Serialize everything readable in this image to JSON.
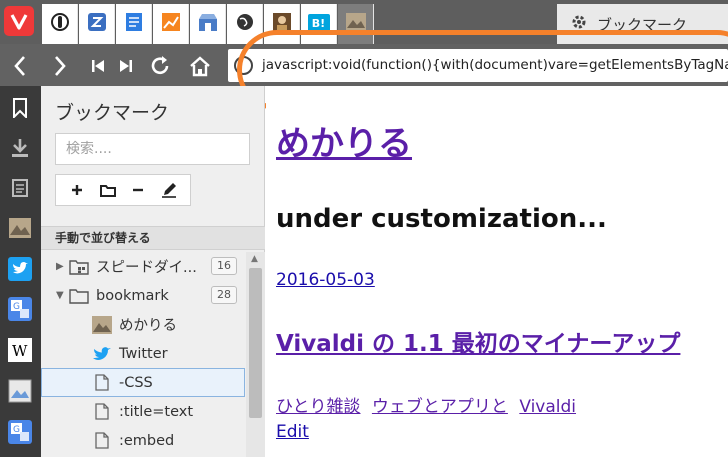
{
  "browser": {
    "logo_icon": "vivaldi-logo",
    "pinned_tabs": [
      {
        "icon": "opera-speed-icon"
      },
      {
        "icon": "z-app-icon"
      },
      {
        "icon": "document-app-icon"
      },
      {
        "icon": "chart-app-icon"
      },
      {
        "icon": "store-app-icon"
      },
      {
        "icon": "globe-icon"
      },
      {
        "icon": "avatar-icon"
      },
      {
        "icon": "hatena-bookmark-icon",
        "text": "B!"
      },
      {
        "icon": "image-thumbnail-icon"
      }
    ],
    "active_tab": {
      "icon": "gear-icon",
      "title": "ブックマーク"
    }
  },
  "addressbar": {
    "url": "javascript:void(function(){with(document)vare=getElementsByTagName",
    "highlight_color": "#f5812b"
  },
  "panel": {
    "title": "ブックマーク",
    "search_placeholder": "検索....",
    "sort_label": "手動で並び替える",
    "tree": [
      {
        "label": "スピードダイ...",
        "count": "16",
        "icon": "speed-dial-folder-icon",
        "arrow": "▶"
      },
      {
        "label": "bookmark",
        "count": "28",
        "icon": "folder-icon",
        "arrow": "▼"
      },
      {
        "label": "めかりる",
        "icon": "site-favicon-icon"
      },
      {
        "label": "Twitter",
        "icon": "twitter-bird-icon"
      },
      {
        "label": "-CSS",
        "icon": "page-icon",
        "selected": true
      },
      {
        "label": ":title=text",
        "icon": "page-icon"
      },
      {
        "label": ":embed",
        "icon": "page-icon"
      }
    ]
  },
  "content": {
    "site_title": "めかりる",
    "tagline": "under customization...",
    "post_date": "2016-05-03",
    "post_title": "Vivaldi の 1.1 最初のマイナーアップ",
    "categories": [
      "ひとり雑談",
      "ウェブとアプリと",
      "Vivaldi"
    ],
    "edit": "Edit"
  },
  "colors": {
    "tab_bar": "#5e5e5e",
    "sidebar_strip": "#3a3a3a",
    "panel_bg": "#efefef",
    "visited_link": "#5a1fa8",
    "link": "#1a0dab",
    "vivaldi_red": "#ef3939"
  }
}
